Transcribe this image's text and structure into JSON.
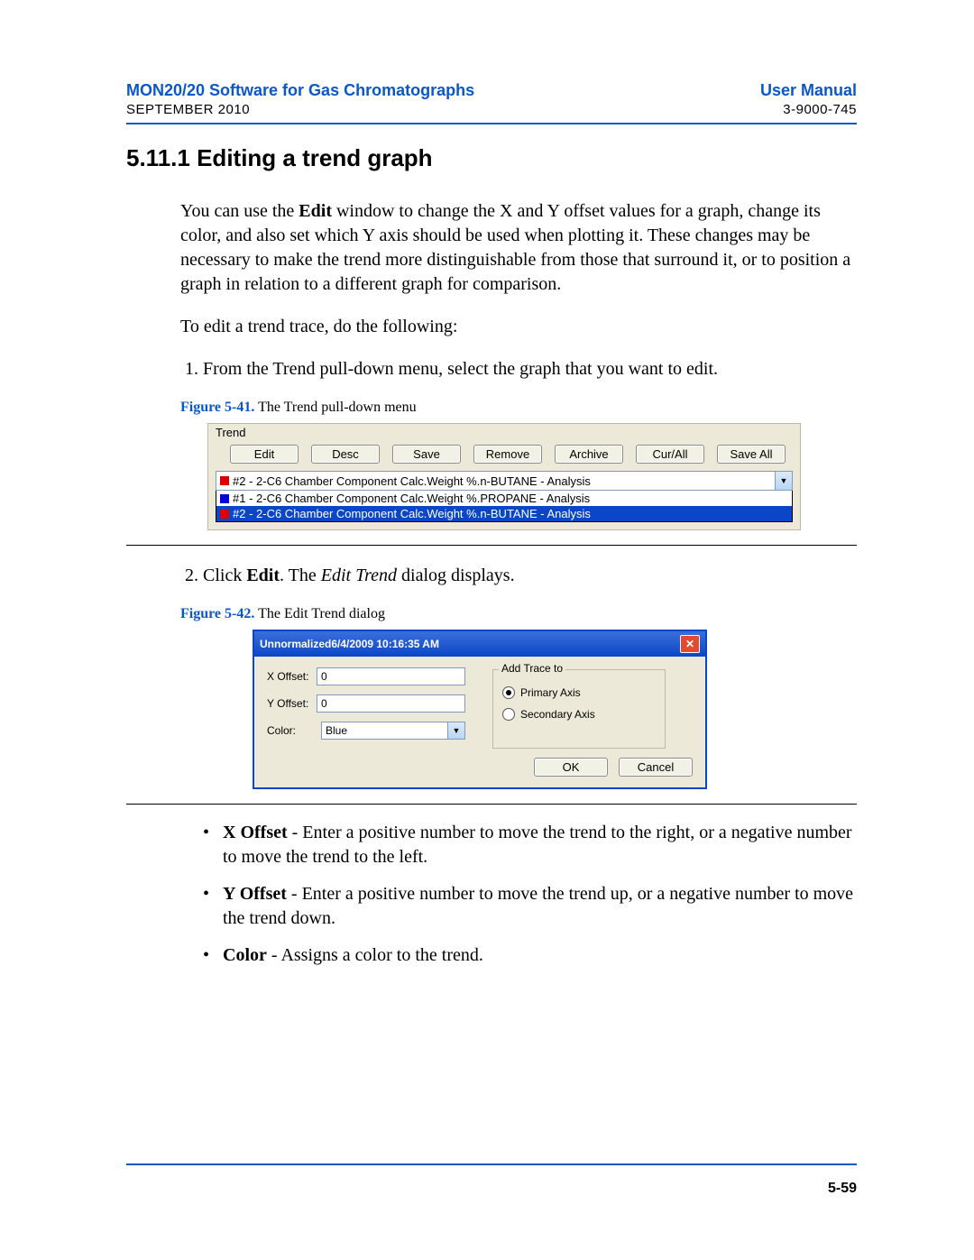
{
  "header": {
    "left_title": "MON20/20 Software for Gas Chromatographs",
    "right_title": "User Manual",
    "left_sub": "SEPTEMBER 2010",
    "right_sub": "3-9000-745"
  },
  "section": {
    "number": "5.11.1",
    "title": "Editing a trend graph"
  },
  "para1_a": "You can use the ",
  "para1_bold": "Edit",
  "para1_b": " window to change the X and Y offset values for a graph, change its color, and also set which Y axis should be used when plotting it.  These changes may be necessary to make the trend more distinguishable from those that surround it, or to position a graph in relation to a different graph for comparison.",
  "para2": "To edit a trend trace, do the following:",
  "step1": "From the Trend pull-down menu, select the graph that you want to edit.",
  "fig41": {
    "label": "Figure 5-41.",
    "caption": "  The Trend pull-down menu"
  },
  "trend_ui": {
    "group_label": "Trend",
    "buttons": [
      "Edit",
      "Desc",
      "Save",
      "Remove",
      "Archive",
      "Cur/All",
      "Save All"
    ],
    "main_item": "#2 - 2-C6 Chamber Component Calc.Weight %.n-BUTANE - Analysis",
    "items": [
      "#1 - 2-C6 Chamber Component Calc.Weight %.PROPANE - Analysis",
      "#2 - 2-C6 Chamber Component Calc.Weight %.n-BUTANE - Analysis"
    ]
  },
  "step2_a": "Click ",
  "step2_b": "Edit",
  "step2_c": ". The ",
  "step2_d": "Edit Trend",
  "step2_e": " dialog displays.",
  "fig42": {
    "label": "Figure 5-42.",
    "caption": "  The Edit Trend dialog"
  },
  "dialog": {
    "title": "Unnormalized6/4/2009 10:16:35 AM",
    "x_label": "X Offset:",
    "x_value": "0",
    "y_label": "Y Offset:",
    "y_value": "0",
    "color_label": "Color:",
    "color_value": "Blue",
    "group_label": "Add Trace to",
    "radio1": "Primary Axis",
    "radio2": "Secondary Axis",
    "ok": "OK",
    "cancel": "Cancel"
  },
  "bullets": {
    "xoff_label": "X Offset",
    "xoff_text": " - Enter a positive number to move the trend to the right, or a negative number to move the trend to the left.",
    "yoff_label": "Y Offset",
    "yoff_text": " - Enter a positive number to move the trend up, or a negative number to move the trend down.",
    "color_label": "Color",
    "color_text": " - Assigns a color to the trend."
  },
  "footer_page": "5-59"
}
